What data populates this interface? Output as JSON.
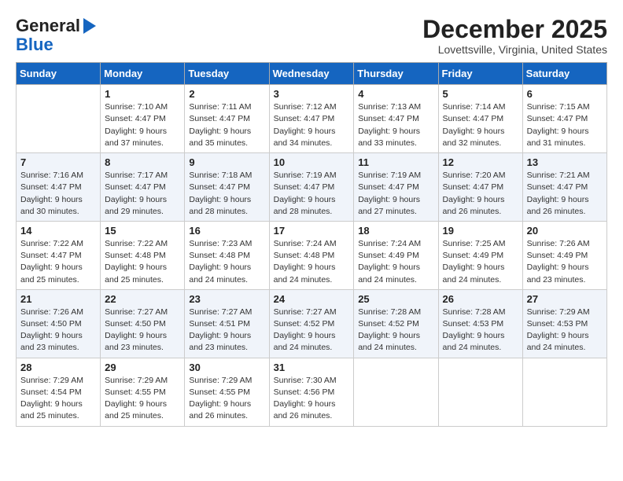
{
  "header": {
    "logo_line1": "General",
    "logo_line2": "Blue",
    "month": "December 2025",
    "location": "Lovettsville, Virginia, United States"
  },
  "days_of_week": [
    "Sunday",
    "Monday",
    "Tuesday",
    "Wednesday",
    "Thursday",
    "Friday",
    "Saturday"
  ],
  "weeks": [
    [
      {
        "day": "",
        "info": ""
      },
      {
        "day": "1",
        "info": "Sunrise: 7:10 AM\nSunset: 4:47 PM\nDaylight: 9 hours\nand 37 minutes."
      },
      {
        "day": "2",
        "info": "Sunrise: 7:11 AM\nSunset: 4:47 PM\nDaylight: 9 hours\nand 35 minutes."
      },
      {
        "day": "3",
        "info": "Sunrise: 7:12 AM\nSunset: 4:47 PM\nDaylight: 9 hours\nand 34 minutes."
      },
      {
        "day": "4",
        "info": "Sunrise: 7:13 AM\nSunset: 4:47 PM\nDaylight: 9 hours\nand 33 minutes."
      },
      {
        "day": "5",
        "info": "Sunrise: 7:14 AM\nSunset: 4:47 PM\nDaylight: 9 hours\nand 32 minutes."
      },
      {
        "day": "6",
        "info": "Sunrise: 7:15 AM\nSunset: 4:47 PM\nDaylight: 9 hours\nand 31 minutes."
      }
    ],
    [
      {
        "day": "7",
        "info": "Sunrise: 7:16 AM\nSunset: 4:47 PM\nDaylight: 9 hours\nand 30 minutes."
      },
      {
        "day": "8",
        "info": "Sunrise: 7:17 AM\nSunset: 4:47 PM\nDaylight: 9 hours\nand 29 minutes."
      },
      {
        "day": "9",
        "info": "Sunrise: 7:18 AM\nSunset: 4:47 PM\nDaylight: 9 hours\nand 28 minutes."
      },
      {
        "day": "10",
        "info": "Sunrise: 7:19 AM\nSunset: 4:47 PM\nDaylight: 9 hours\nand 28 minutes."
      },
      {
        "day": "11",
        "info": "Sunrise: 7:19 AM\nSunset: 4:47 PM\nDaylight: 9 hours\nand 27 minutes."
      },
      {
        "day": "12",
        "info": "Sunrise: 7:20 AM\nSunset: 4:47 PM\nDaylight: 9 hours\nand 26 minutes."
      },
      {
        "day": "13",
        "info": "Sunrise: 7:21 AM\nSunset: 4:47 PM\nDaylight: 9 hours\nand 26 minutes."
      }
    ],
    [
      {
        "day": "14",
        "info": "Sunrise: 7:22 AM\nSunset: 4:47 PM\nDaylight: 9 hours\nand 25 minutes."
      },
      {
        "day": "15",
        "info": "Sunrise: 7:22 AM\nSunset: 4:48 PM\nDaylight: 9 hours\nand 25 minutes."
      },
      {
        "day": "16",
        "info": "Sunrise: 7:23 AM\nSunset: 4:48 PM\nDaylight: 9 hours\nand 24 minutes."
      },
      {
        "day": "17",
        "info": "Sunrise: 7:24 AM\nSunset: 4:48 PM\nDaylight: 9 hours\nand 24 minutes."
      },
      {
        "day": "18",
        "info": "Sunrise: 7:24 AM\nSunset: 4:49 PM\nDaylight: 9 hours\nand 24 minutes."
      },
      {
        "day": "19",
        "info": "Sunrise: 7:25 AM\nSunset: 4:49 PM\nDaylight: 9 hours\nand 24 minutes."
      },
      {
        "day": "20",
        "info": "Sunrise: 7:26 AM\nSunset: 4:49 PM\nDaylight: 9 hours\nand 23 minutes."
      }
    ],
    [
      {
        "day": "21",
        "info": "Sunrise: 7:26 AM\nSunset: 4:50 PM\nDaylight: 9 hours\nand 23 minutes."
      },
      {
        "day": "22",
        "info": "Sunrise: 7:27 AM\nSunset: 4:50 PM\nDaylight: 9 hours\nand 23 minutes."
      },
      {
        "day": "23",
        "info": "Sunrise: 7:27 AM\nSunset: 4:51 PM\nDaylight: 9 hours\nand 23 minutes."
      },
      {
        "day": "24",
        "info": "Sunrise: 7:27 AM\nSunset: 4:52 PM\nDaylight: 9 hours\nand 24 minutes."
      },
      {
        "day": "25",
        "info": "Sunrise: 7:28 AM\nSunset: 4:52 PM\nDaylight: 9 hours\nand 24 minutes."
      },
      {
        "day": "26",
        "info": "Sunrise: 7:28 AM\nSunset: 4:53 PM\nDaylight: 9 hours\nand 24 minutes."
      },
      {
        "day": "27",
        "info": "Sunrise: 7:29 AM\nSunset: 4:53 PM\nDaylight: 9 hours\nand 24 minutes."
      }
    ],
    [
      {
        "day": "28",
        "info": "Sunrise: 7:29 AM\nSunset: 4:54 PM\nDaylight: 9 hours\nand 25 minutes."
      },
      {
        "day": "29",
        "info": "Sunrise: 7:29 AM\nSunset: 4:55 PM\nDaylight: 9 hours\nand 25 minutes."
      },
      {
        "day": "30",
        "info": "Sunrise: 7:29 AM\nSunset: 4:55 PM\nDaylight: 9 hours\nand 26 minutes."
      },
      {
        "day": "31",
        "info": "Sunrise: 7:30 AM\nSunset: 4:56 PM\nDaylight: 9 hours\nand 26 minutes."
      },
      {
        "day": "",
        "info": ""
      },
      {
        "day": "",
        "info": ""
      },
      {
        "day": "",
        "info": ""
      }
    ]
  ]
}
